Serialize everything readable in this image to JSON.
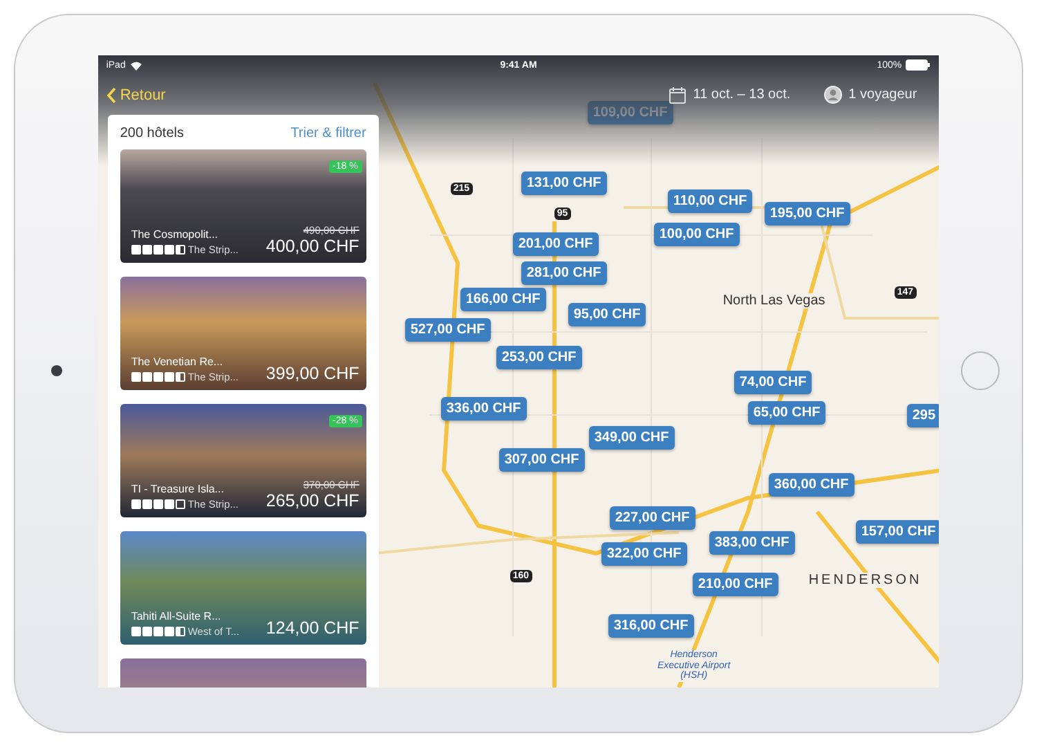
{
  "status_bar": {
    "carrier": "iPad",
    "time": "9:41 AM",
    "battery": "100%"
  },
  "nav": {
    "back": "Retour",
    "dates": "11 oct. – 13 oct.",
    "travelers": "1 voyageur"
  },
  "list": {
    "count": "200 hôtels",
    "sort_filter": "Trier & filtrer",
    "hotels": [
      {
        "name": "The Cosmopolit...",
        "stars": 4.5,
        "area": "The Strip...",
        "old_price": "490,00 CHF",
        "price": "400,00 CHF",
        "discount": "-18 %"
      },
      {
        "name": "The Venetian Re...",
        "stars": 4.5,
        "area": "The Strip...",
        "price": "399,00 CHF"
      },
      {
        "name": "TI - Treasure Isla...",
        "stars": 4,
        "area": "The Strip...",
        "old_price": "370,00 CHF",
        "price": "265,00 CHF",
        "discount": "-28 %"
      },
      {
        "name": "Tahiti All-Suite R...",
        "stars": 4.5,
        "area": "West of T...",
        "price": "124,00 CHF"
      }
    ]
  },
  "map": {
    "labels": [
      {
        "kind": "place",
        "text": "North Las Vegas"
      },
      {
        "kind": "place",
        "text": "HENDERSON"
      },
      {
        "kind": "airport",
        "text": "Henderson Executive Airport (HSH)"
      },
      {
        "kind": "shield",
        "text": "215"
      },
      {
        "kind": "shield",
        "text": "95"
      },
      {
        "kind": "shield",
        "text": "147"
      },
      {
        "kind": "shield",
        "text": "160"
      }
    ],
    "pins": [
      "109,00 CHF",
      "131,00 CHF",
      "110,00 CHF",
      "195,00 CHF",
      "100,00 CHF",
      "201,00 CHF",
      "281,00 CHF",
      "95,00 CHF",
      "166,00 CHF",
      "527,00 CHF",
      "253,00 CHF",
      "336,00 CHF",
      "74,00 CHF",
      "65,00 CHF",
      "307,00 CHF",
      "349,00 CHF",
      "360,00 CHF",
      "227,00 CHF",
      "383,00 CHF",
      "157,00 CHF",
      "322,00 CHF",
      "210,00 CHF",
      "316,00 CHF",
      "295"
    ]
  }
}
